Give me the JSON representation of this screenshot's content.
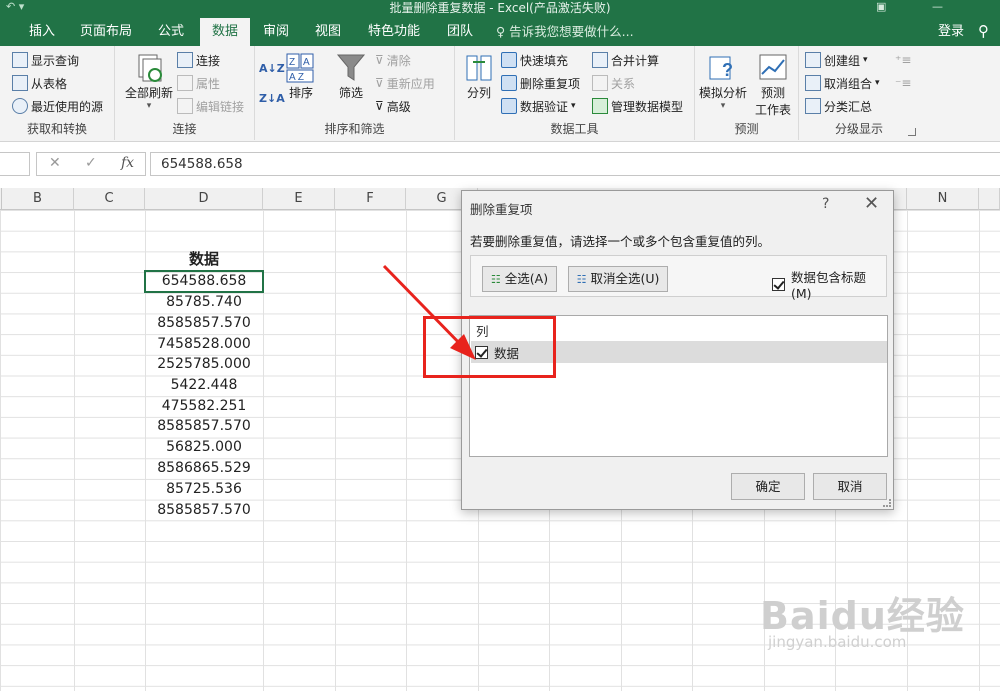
{
  "window": {
    "title": "批量删除重复数据 - Excel(产品激活失败)"
  },
  "tabs": [
    {
      "label": "插入"
    },
    {
      "label": "页面布局"
    },
    {
      "label": "公式"
    },
    {
      "label": "数据"
    },
    {
      "label": "审阅"
    },
    {
      "label": "视图"
    },
    {
      "label": "特色功能"
    },
    {
      "label": "团队"
    }
  ],
  "tell_me": "告诉我您想要做什么...",
  "login_label": "登录",
  "ribbon": {
    "get_transform": {
      "show_query": "显示查询",
      "from_table": "从表格",
      "recent_sources": "最近使用的源",
      "label": "获取和转换"
    },
    "connections": {
      "refresh_all": "全部刷新",
      "connections": "连接",
      "properties": "属性",
      "edit_links": "编辑链接",
      "label": "连接"
    },
    "sort_filter": {
      "sort": "排序",
      "filter": "筛选",
      "clear": "清除",
      "reapply": "重新应用",
      "advanced": "高级",
      "label": "排序和筛选"
    },
    "data_tools": {
      "text_to_columns": "分列",
      "flash_fill": "快速填充",
      "remove_duplicates": "删除重复项",
      "data_validation": "数据验证",
      "consolidate": "合并计算",
      "relationships": "关系",
      "manage_model": "管理数据模型",
      "label": "数据工具"
    },
    "forecast": {
      "what_if": "模拟分析",
      "forecast_sheet_1": "预测",
      "forecast_sheet_2": "工作表",
      "label": "预测"
    },
    "outline": {
      "group": "创建组",
      "ungroup": "取消组合",
      "subtotal": "分类汇总",
      "label": "分级显示"
    }
  },
  "formula_bar": {
    "fx": "fx",
    "value": "654588.658"
  },
  "columns": [
    "B",
    "C",
    "D",
    "E",
    "F",
    "G",
    "N"
  ],
  "cells": {
    "header": "数据",
    "values": [
      "654588.658",
      "85785.740",
      "8585857.570",
      "7458528.000",
      "2525785.000",
      "5422.448",
      "475582.251",
      "8585857.570",
      "56825.000",
      "8586865.529",
      "85725.536",
      "8585857.570"
    ]
  },
  "dialog": {
    "title": "删除重复项",
    "help": "?",
    "instruction": "若要删除重复值，请选择一个或多个包含重复值的列。",
    "select_all": "全选(A)",
    "unselect_all": "取消全选(U)",
    "has_headers": "数据包含标题(M)",
    "list_header": "列",
    "list_items": [
      {
        "label": "数据",
        "checked": true
      }
    ],
    "ok": "确定",
    "cancel": "取消"
  },
  "watermark": {
    "main": "Baidu经验",
    "sub": "jingyan.baidu.com"
  },
  "colors": {
    "excel_green": "#217346",
    "annotation_red": "#e8231d"
  }
}
